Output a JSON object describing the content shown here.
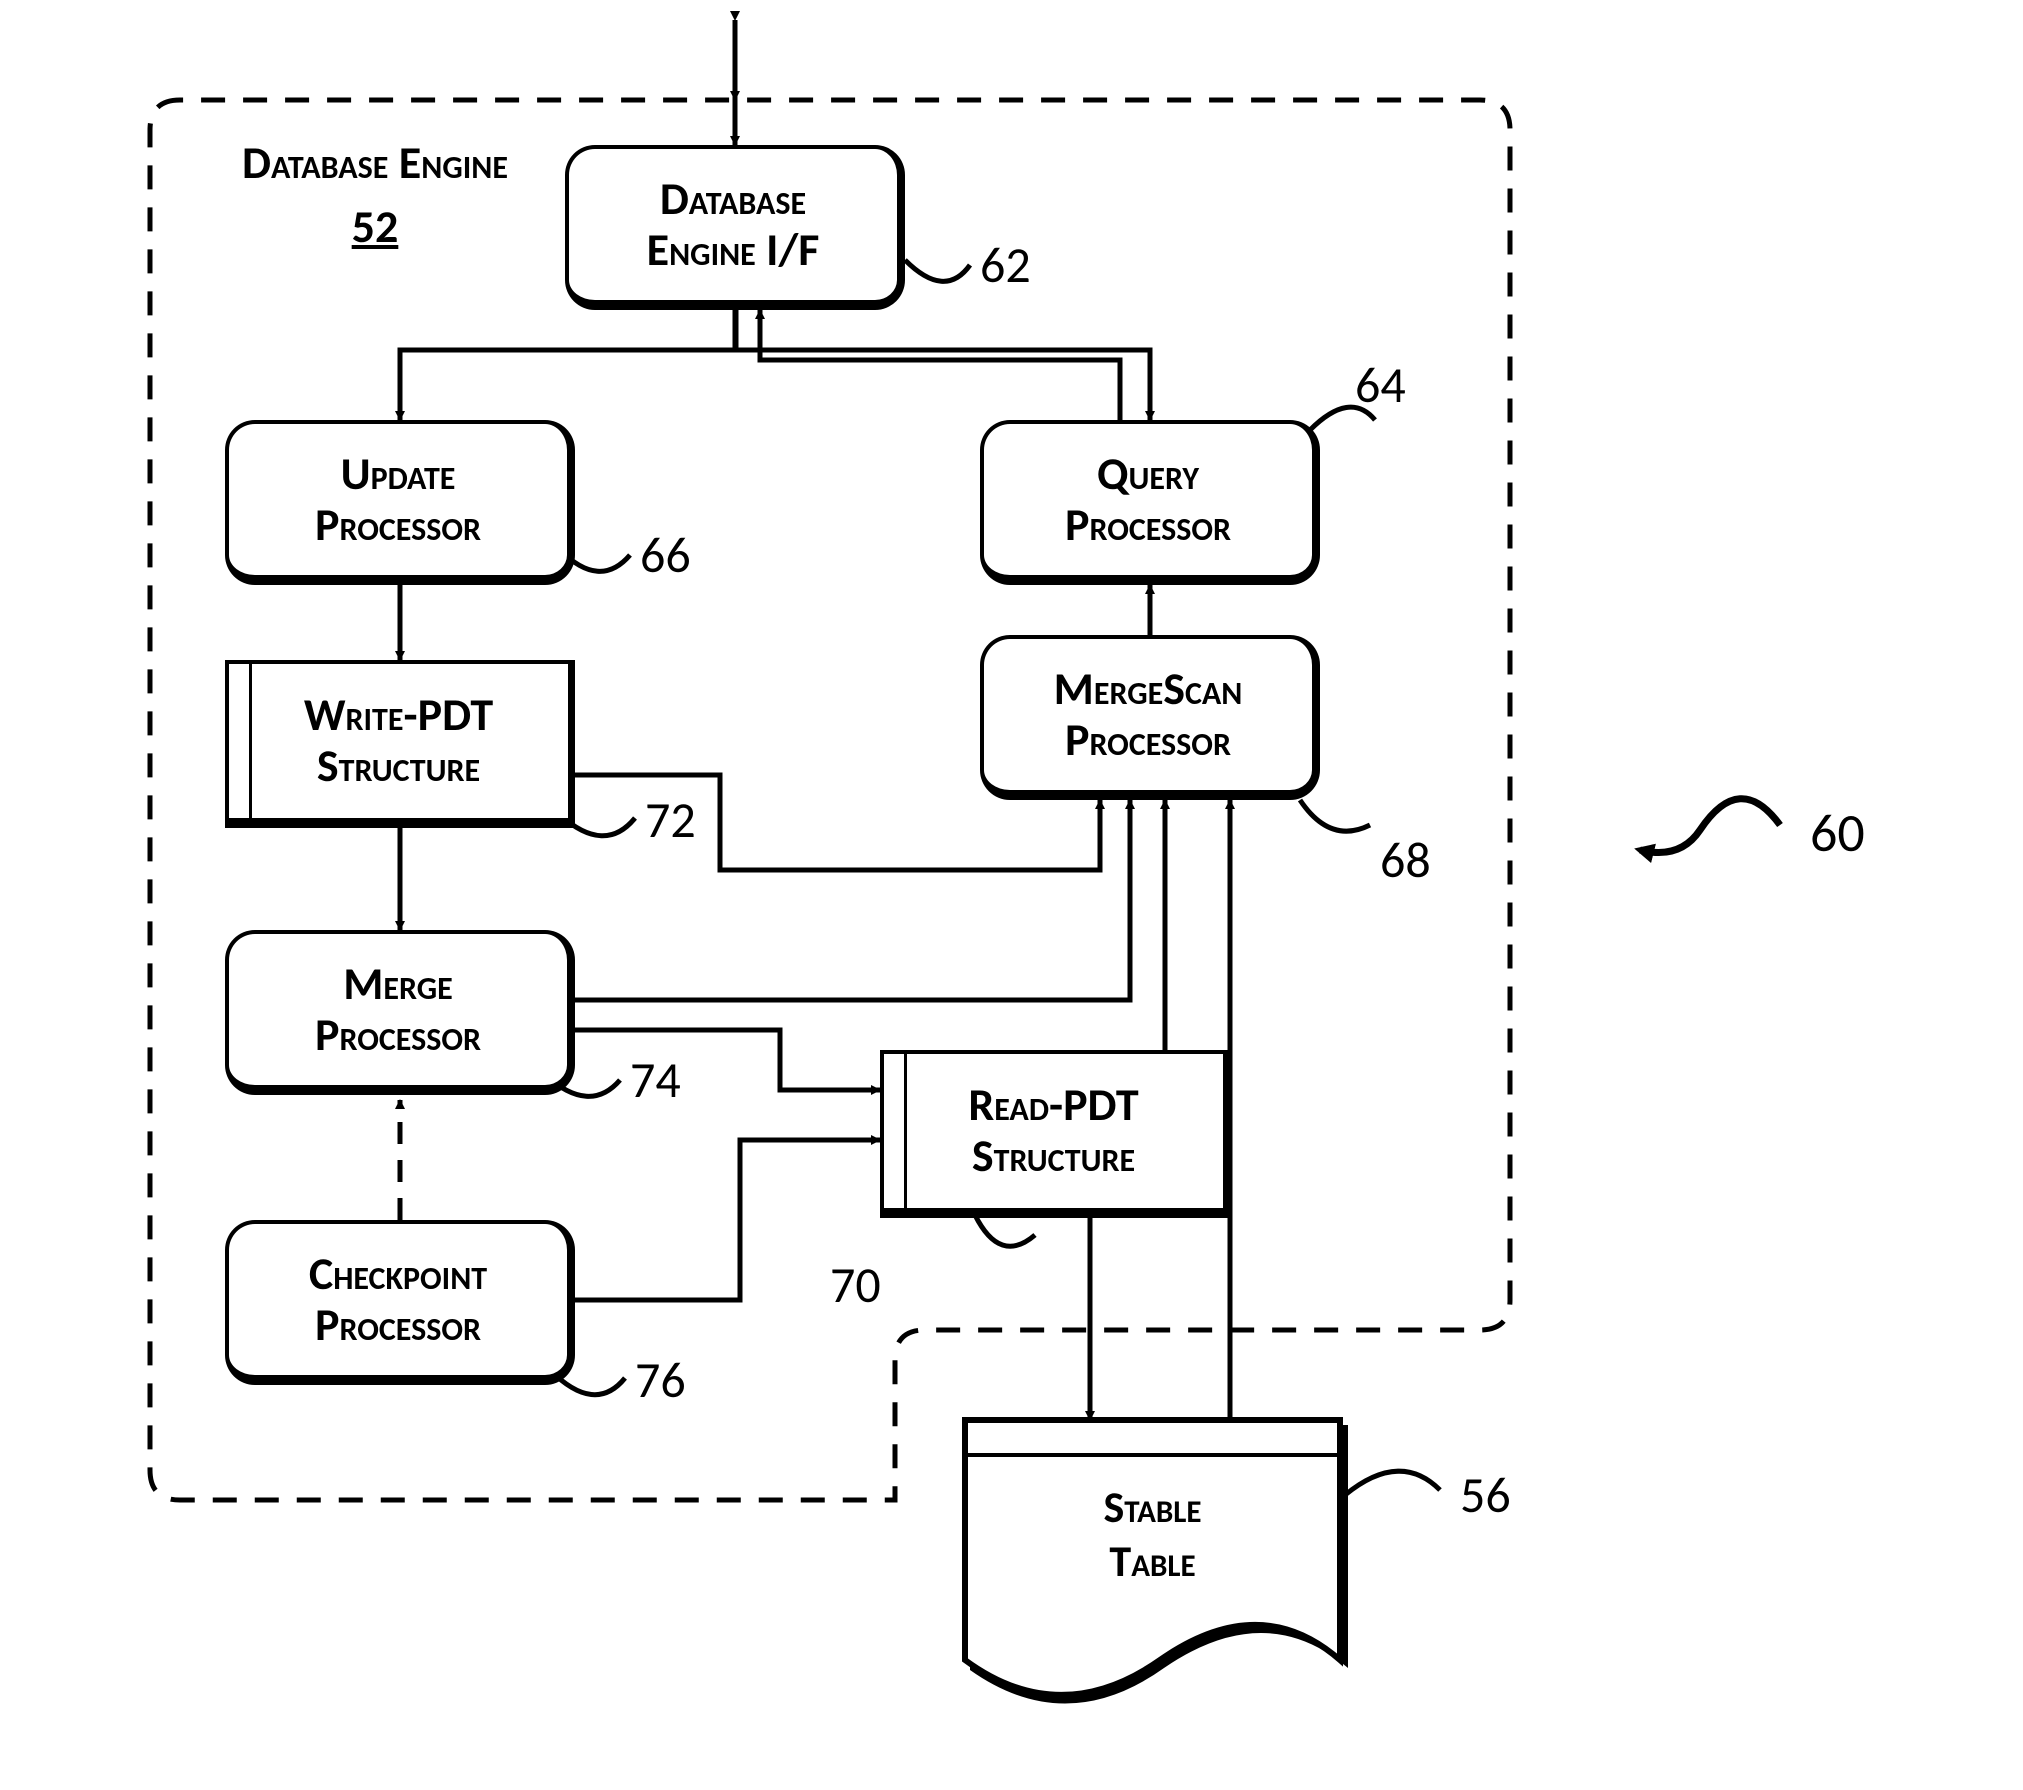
{
  "title": {
    "text": "Database Engine",
    "num": "52"
  },
  "boxes": {
    "engine_if": {
      "label": "Database\nEngine I/F",
      "ref": "62"
    },
    "update_proc": {
      "label": "Update\nProcessor",
      "ref": "66"
    },
    "query_proc": {
      "label": "Query\nProcessor",
      "ref": "64"
    },
    "write_pdt": {
      "label": "Write-PDT\nStructure",
      "ref": "72"
    },
    "mergescan": {
      "label": "MergeScan\nProcessor",
      "ref": "68"
    },
    "merge_proc": {
      "label": "Merge\nProcessor",
      "ref": "74"
    },
    "read_pdt": {
      "label": "Read-PDT\nStructure",
      "ref": "70"
    },
    "checkpoint": {
      "label": "Checkpoint\nProcessor",
      "ref": "76"
    },
    "stable_table": {
      "label": "Stable\nTable",
      "ref": "56"
    }
  },
  "figure_ref": "60"
}
